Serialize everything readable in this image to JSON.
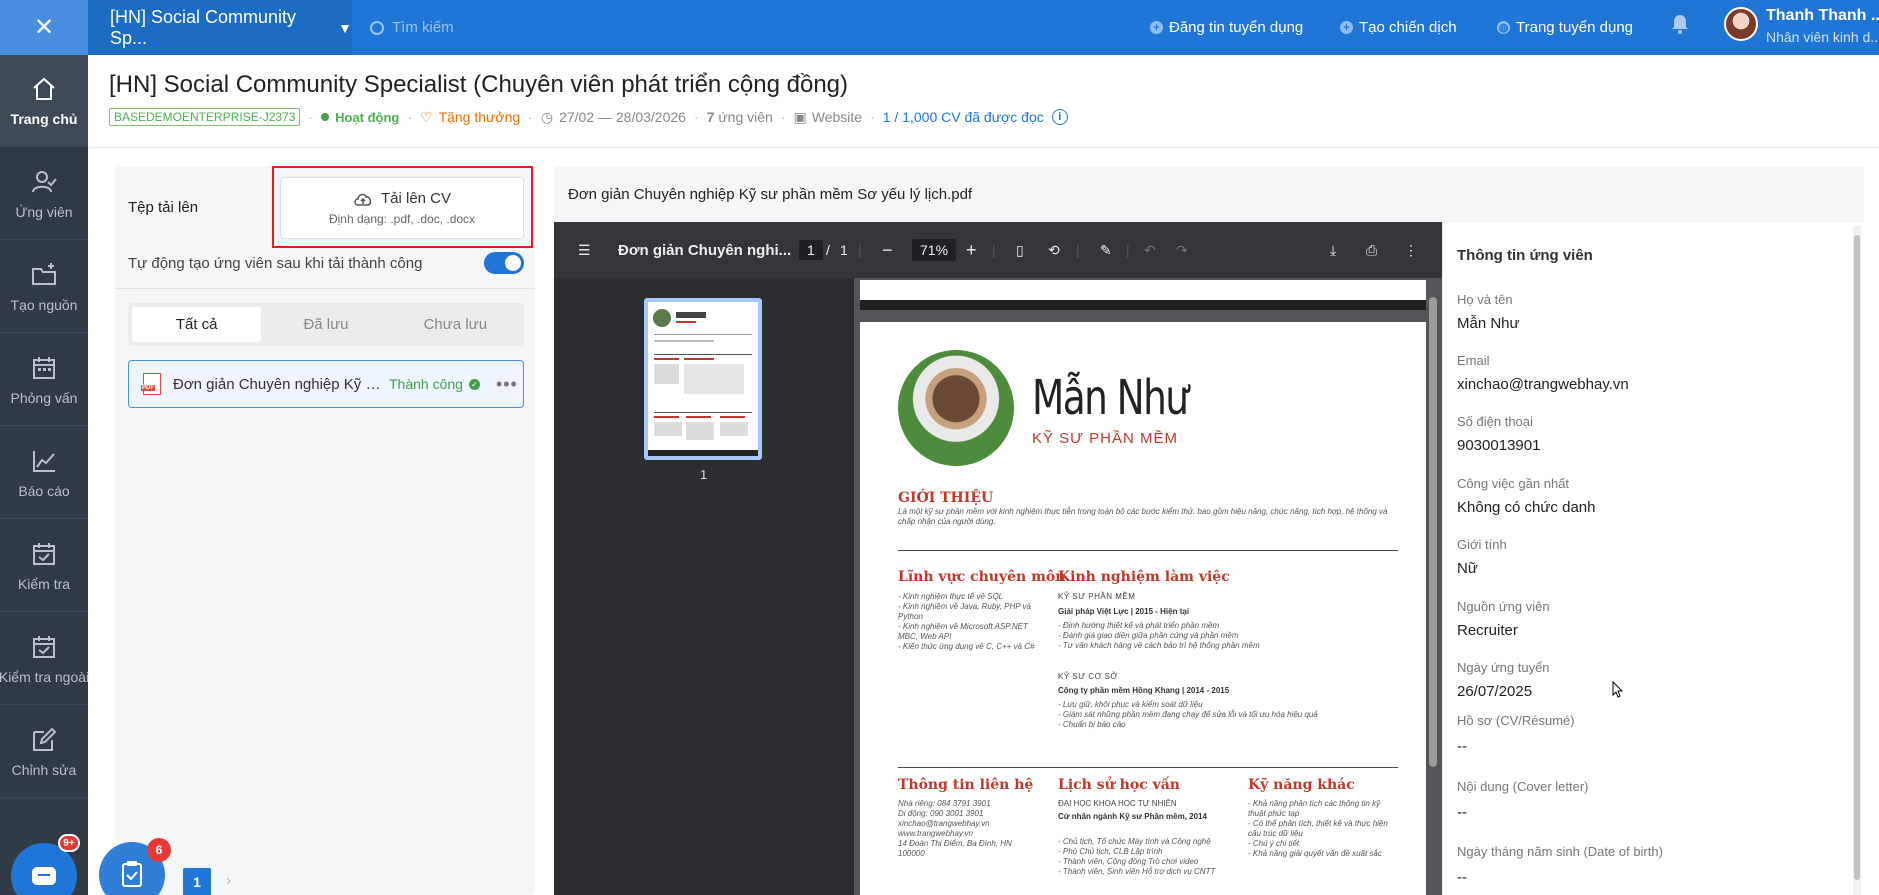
{
  "topbar": {
    "close": "✕",
    "job_selector": "[HN] Social Community Sp...",
    "search_placeholder": "Tìm kiếm",
    "post_job": "Đăng tin tuyển dụng",
    "create_campaign": "Tạo chiến dịch",
    "career_page": "Trang tuyển dụng",
    "user_name": "Thanh Thanh ...",
    "user_role": "Nhân viên kinh d..."
  },
  "sidebar": {
    "items": [
      {
        "label": "Trang chủ",
        "icon": "home-icon"
      },
      {
        "label": "Ứng viên",
        "icon": "user-check-icon"
      },
      {
        "label": "Tạo nguồn",
        "icon": "folder-plus-icon"
      },
      {
        "label": "Phỏng vấn",
        "icon": "calendar-icon"
      },
      {
        "label": "Báo cáo",
        "icon": "chart-line-icon"
      },
      {
        "label": "Kiểm tra",
        "icon": "calendar-check-icon"
      },
      {
        "label": "Kiểm tra ngoài",
        "icon": "calendar-check-icon"
      },
      {
        "label": "Chỉnh sửa",
        "icon": "edit-icon"
      }
    ],
    "chat_badge": "9+"
  },
  "header": {
    "title": "[HN] Social Community Specialist (Chuyên viên phát triển cộng đồng)",
    "code": "BASEDEMOENTERPRISE-J2373",
    "status": "Hoạt động",
    "reward": "Tặng thưởng",
    "date_range": "27/02 — 28/03/2026",
    "applicants_num": "7",
    "applicants_label": "ứng viên",
    "source": "Website",
    "cv_quota": "1 / 1,000 CV đã được đọc"
  },
  "upload": {
    "label": "Tệp tải lên",
    "button": "Tải lên CV",
    "formats": "Định dạng: .pdf, .doc, .docx",
    "auto_create": "Tự động tạo ứng viên sau khi tải thành công",
    "auto_enabled": true,
    "tabs": [
      "Tất cả",
      "Đã lưu",
      "Chưa lưu"
    ],
    "active_tab": "Tất cả",
    "file": {
      "name": "Đơn giản Chuyên nghiệp Kỹ s...",
      "status": "Thành công"
    },
    "task_badge": "6",
    "page": "1"
  },
  "viewer": {
    "doc_title": "Đơn giản Chuyên nghiệp Kỹ sư phần mềm Sơ yếu lý lịch.pdf",
    "toolbar_name": "Đơn giản Chuyên nghi...",
    "page_current": "1",
    "page_sep": "/",
    "page_total": "1",
    "zoom": "71%",
    "thumb_number": "1"
  },
  "resume": {
    "name": "Mẫn Như",
    "role": "KỸ SƯ PHẦN MỀM",
    "intro_h": "GIỚI THIỆU",
    "intro": "Là một kỹ sư phần mềm với kinh nghiệm thực tiễn trong toàn bộ các bước kiểm thử, bao gồm hiệu năng, chức năng, tích hợp, hệ thống và chấp nhận của người dùng.",
    "skills_h": "Lĩnh vực chuyên môn",
    "skills": "- Kinh nghiệm thực tế về SQL\n- Kinh nghiệm về Java, Ruby, PHP và Python\n- Kinh nghiệm về Microsoft ASP.NET MBC, Web API\n- Kiến thức ứng dụng về C, C++ và C#",
    "exp_h": "Kinh nghiệm làm việc",
    "job1_title": "KỸ SƯ PHẦN MỀM",
    "job1_company": "Giải pháp Việt Lực | 2015 - Hiện tại",
    "job1_desc": "- Định hướng thiết kế và phát triển phần mềm\n- Đánh giá giao diện giữa phần cứng và phần mềm\n- Tư vấn khách hàng về cách bảo trì hệ thống phần mềm",
    "job2_title": "KỸ SƯ CƠ SỞ",
    "job2_company": "Công ty phần mềm Hồng Khang | 2014 - 2015",
    "job2_desc": "- Lưu giữ, khôi phục và kiểm soát dữ liệu\n- Giám sát những phần mềm đang chạy để sửa lỗi và tối ưu hóa hiệu quả\n- Chuẩn bị báo cáo",
    "contact_h": "Thông tin liên hệ",
    "contact": "Nhà riêng: 084 3791 3901\nDi động: 090 3001 3901\nxinchao@trangwebhay.vn\nwww.trangwebhay.vn\n14 Đoàn Thị Điểm, Ba Đình, HN 100000",
    "edu_h": "Lịch sử học vấn",
    "edu_school": "ĐẠI HỌC KHOA HỌC TỰ NHIÊN",
    "edu_degree": "Cử nhân ngành Kỹ sư Phần mềm, 2014",
    "edu_desc": "- Chủ tịch, Tổ chức Máy tính và Công nghệ\n- Phó Chủ tịch, CLB Lập trình\n- Thành viên, Cộng đồng Trò chơi video\n- Thành viên, Sinh viên Hỗ trợ dịch vụ CNTT",
    "other_h": "Kỹ năng khác",
    "other": "- Khả năng phân tích các thông tin kỹ thuật phức tạp\n- Có thể phân tích, thiết kế và thực hiện cấu trúc dữ liệu\n- Chú ý chi tiết\n- Khả năng giải quyết vấn đề xuất sắc"
  },
  "candidate": {
    "title": "Thông tin ứng viên",
    "fields": [
      {
        "label": "Họ và tên",
        "value": "Mẫn Như"
      },
      {
        "label": "Email",
        "value": "xinchao@trangwebhay.vn"
      },
      {
        "label": "Số điện thoại",
        "value": "9030013901"
      },
      {
        "label": "Công việc gần nhất",
        "value": "Không có chức danh"
      },
      {
        "label": "Giới tính",
        "value": "Nữ"
      },
      {
        "label": "Nguồn ứng viên",
        "value": "Recruiter"
      },
      {
        "label": "Ngày ứng tuyển",
        "value": "26/07/2025"
      },
      {
        "label": "Hồ sơ (CV/Résumé)",
        "value": "--"
      },
      {
        "label": "Nội dung (Cover letter)",
        "value": "--"
      },
      {
        "label": "Ngày tháng năm sinh (Date of birth)",
        "value": "--"
      }
    ]
  },
  "colors": {
    "primary": "#1f76d6",
    "success": "#43a047",
    "highlight": "#e02020",
    "reward": "#ef6c00",
    "resume_accent": "#c0392b"
  }
}
